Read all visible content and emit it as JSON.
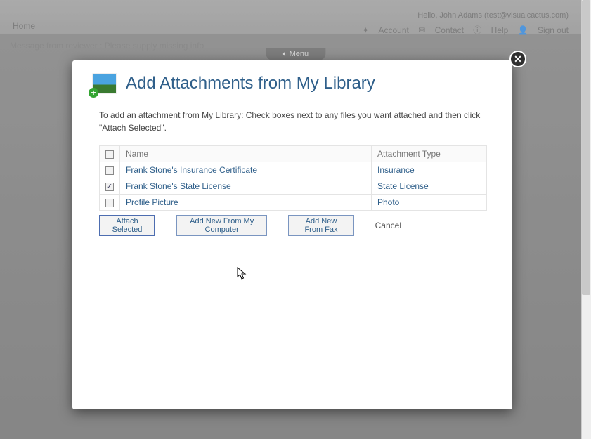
{
  "background": {
    "greeting": "Hello, John Adams (test@visualcactus.com)",
    "home": "Home",
    "nav": {
      "account": "Account",
      "contact": "Contact",
      "help": "Help",
      "signout": "Sign out"
    },
    "message_bar": "Message from reviewer : Please supply missing info",
    "menu_tab": "Menu"
  },
  "modal": {
    "title": "Add Attachments from My Library",
    "instructions": "To add an attachment from My Library: Check boxes next to any files you want attached and then click \"Attach Selected\".",
    "columns": {
      "name": "Name",
      "type": "Attachment Type"
    },
    "rows": [
      {
        "checked": false,
        "name": "Frank Stone's Insurance Certificate",
        "type": "Insurance"
      },
      {
        "checked": true,
        "name": "Frank Stone's State License",
        "type": "State License"
      },
      {
        "checked": false,
        "name": "Profile Picture",
        "type": "Photo"
      }
    ],
    "buttons": {
      "attach": "Attach Selected",
      "add_computer": "Add New From My Computer",
      "add_fax": "Add New From Fax",
      "cancel": "Cancel"
    }
  }
}
